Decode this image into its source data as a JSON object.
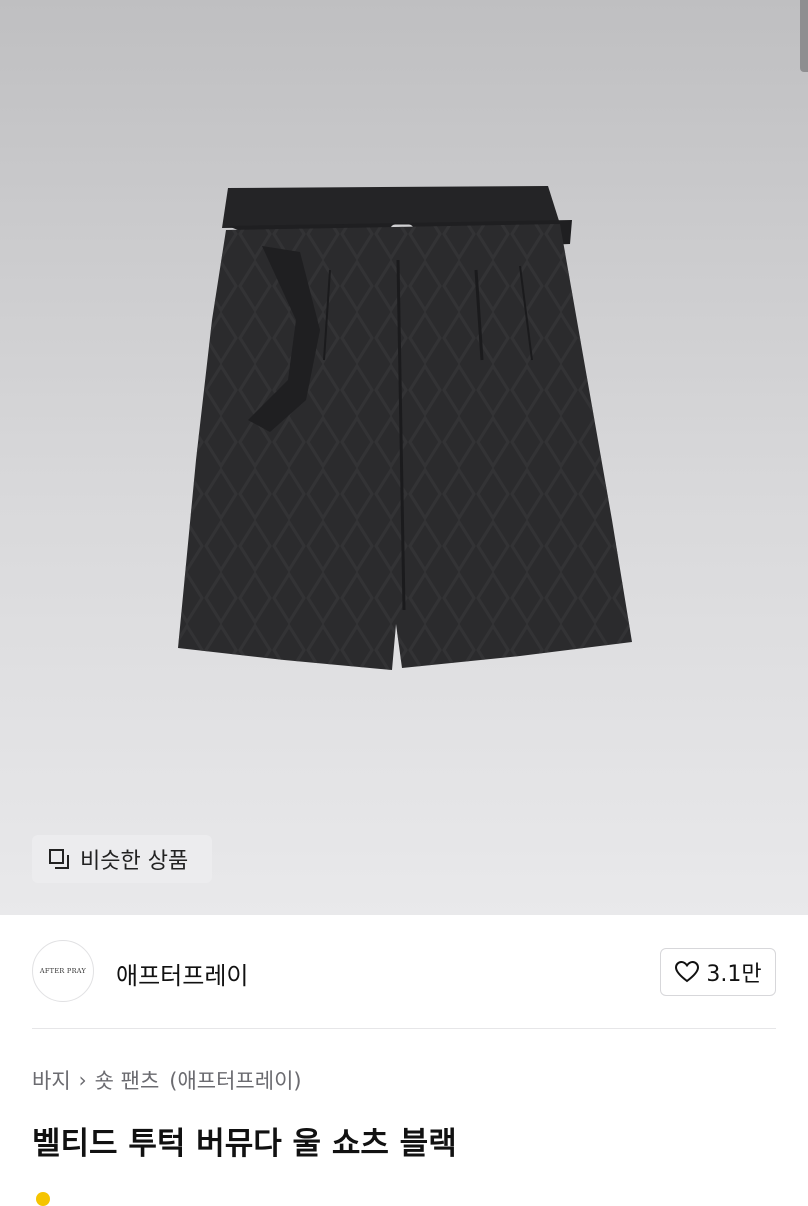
{
  "hero": {
    "similar_button_label": "비슷한 상품",
    "similar_icon": "copy-squares-icon",
    "product_image_icon": "shorts-photo"
  },
  "seller": {
    "logo_text": "AFTER PRAY",
    "name": "애프터프레이",
    "likes_label": "3.1만",
    "like_icon": "heart-outline-icon"
  },
  "breadcrumb": {
    "category": "바지",
    "separator_icon": "chevron-right-icon",
    "subcategory": "숏 팬츠",
    "brand": "(애프터프레이)"
  },
  "product": {
    "title": "벨티드 투턱 버뮤다 울 쇼츠 블랙"
  },
  "colors": {
    "hero_bg_top": "#bfbfc1",
    "hero_bg_bottom": "#e9e9eb",
    "garment": "#2b2b2d",
    "accent_yellow": "#f5c400"
  }
}
